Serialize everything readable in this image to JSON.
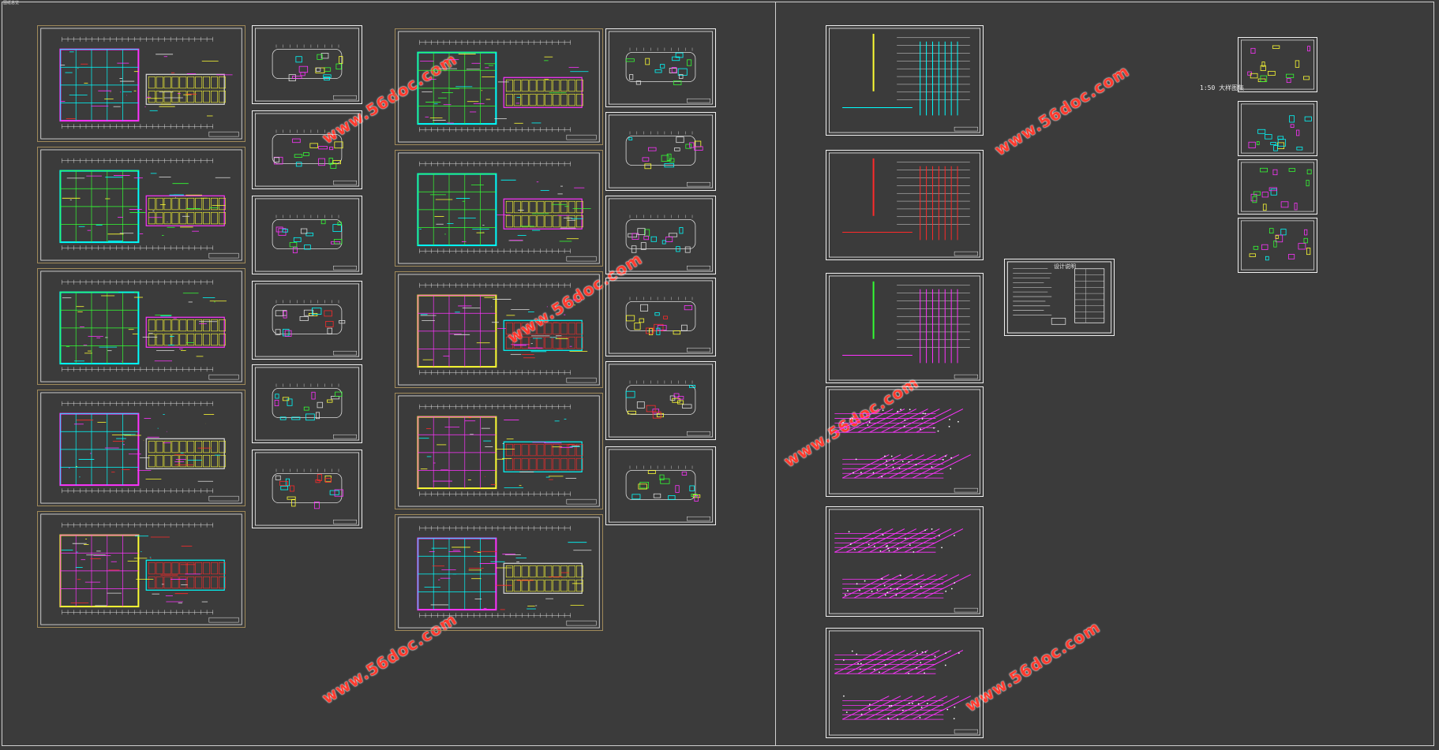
{
  "window": {
    "title": "图纸总览"
  },
  "watermark": {
    "text": "www.56doc.com",
    "color": "#ff3b2f"
  },
  "side_label": {
    "text": "1:50 大样图集"
  },
  "colors": {
    "background": "#3b3b3b",
    "gold_frame": "#a08a5a",
    "white_frame": "#f0f0f0",
    "magenta": "#ff33ff",
    "cyan": "#00ffff",
    "red": "#ff2a2a",
    "green": "#33ff33",
    "yellow": "#ffff33"
  },
  "sheets": {
    "left_plans": [
      "平面图-1",
      "平面图-2",
      "平面图-3",
      "平面图-4",
      "平面图-5"
    ],
    "mid_plans": [
      "平面图-6",
      "平面图-7",
      "平面图-8",
      "平面图-9",
      "平面图-10"
    ],
    "small_plans_a": [
      "小平面-1",
      "小平面-2",
      "小平面-3",
      "小平面-4",
      "小平面-5",
      "小平面-6"
    ],
    "small_plans_b": [
      "小平面-7",
      "小平面-8",
      "小平面-9",
      "小平面-10",
      "小平面-11",
      "小平面-12"
    ],
    "systems": [
      "系统图-1",
      "系统图-2",
      "系统图-3",
      "系统图-4",
      "系统图-5",
      "系统图-6"
    ],
    "legend": "设计说明",
    "details": [
      "大样-1",
      "大样-2",
      "大样-3",
      "大样-4"
    ]
  }
}
